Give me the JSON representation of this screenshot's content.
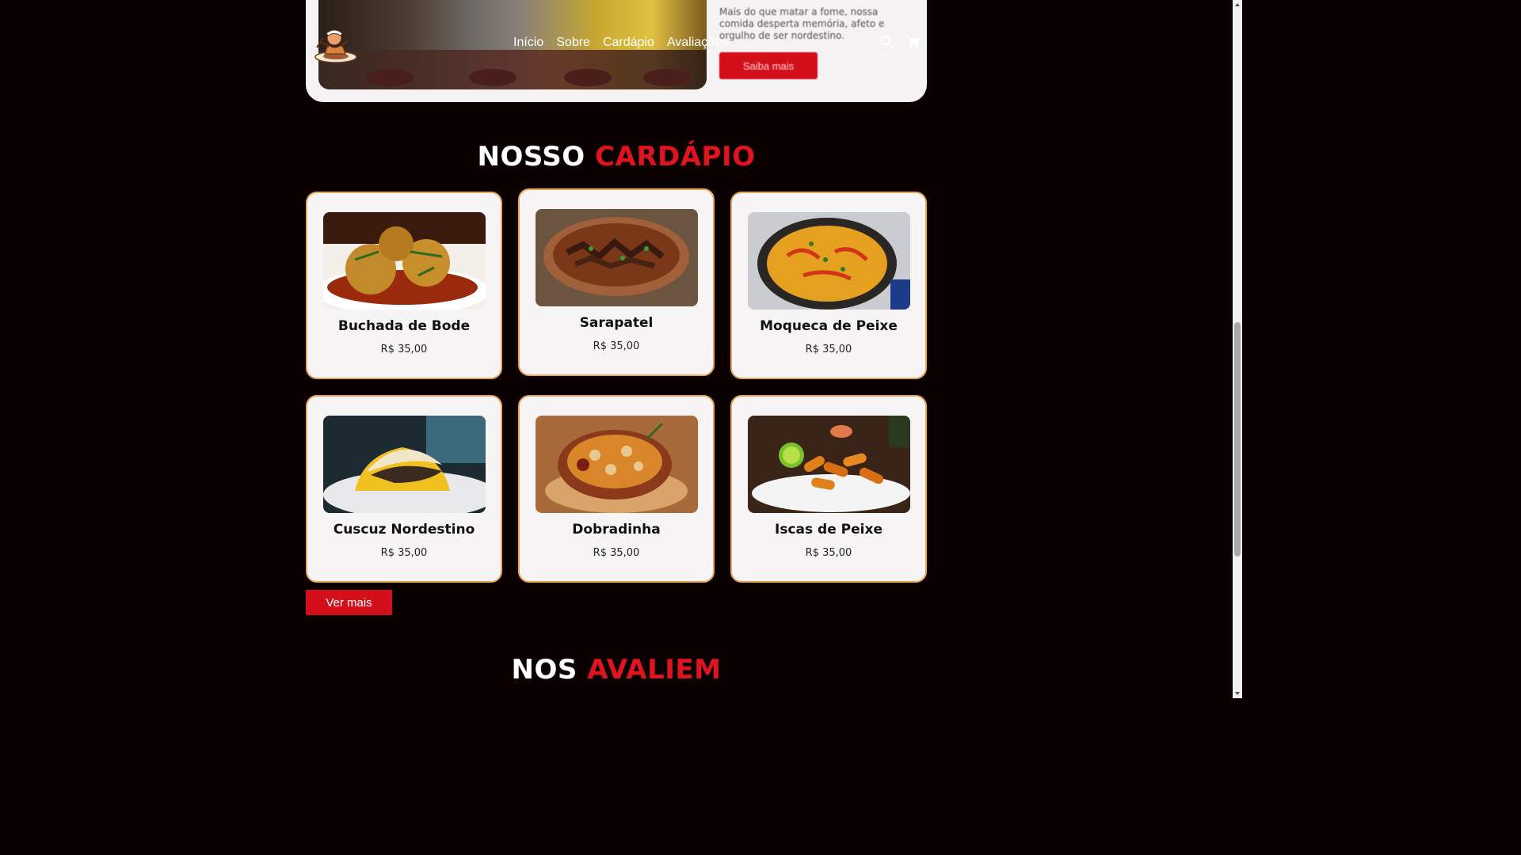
{
  "about": {
    "text": "Mais do que matar a fome, nossa comida desperta memória, afeto e orgulho de ser nordestino.",
    "button_label": "Saiba mais"
  },
  "header": {
    "logo_icon": "chef-mascot-logo",
    "nav": [
      "Início",
      "Sobre",
      "Cardápio",
      "Avaliações"
    ],
    "search_icon": "search-icon",
    "cart_icon": "cart-icon"
  },
  "menu": {
    "title_white": "NOSSO",
    "title_red": "CARDÁPIO",
    "items": [
      {
        "name": "Buchada de Bode",
        "price": "R$ 35,00"
      },
      {
        "name": "Sarapatel",
        "price": "R$ 35,00"
      },
      {
        "name": "Moqueca de Peixe",
        "price": "R$ 35,00"
      },
      {
        "name": "Cuscuz Nordestino",
        "price": "R$ 35,00"
      },
      {
        "name": "Dobradinha",
        "price": "R$ 35,00"
      },
      {
        "name": "Iscas de Peixe",
        "price": "R$ 35,00"
      }
    ],
    "more_label": "Ver mais"
  },
  "reviews": {
    "title_white": "NOS",
    "title_red": "AVALIEM"
  },
  "colors": {
    "background": "#0a0000",
    "accent_red": "#d30f1b",
    "card_border": "#e7a65a",
    "card_bg": "#f6f4f4"
  }
}
